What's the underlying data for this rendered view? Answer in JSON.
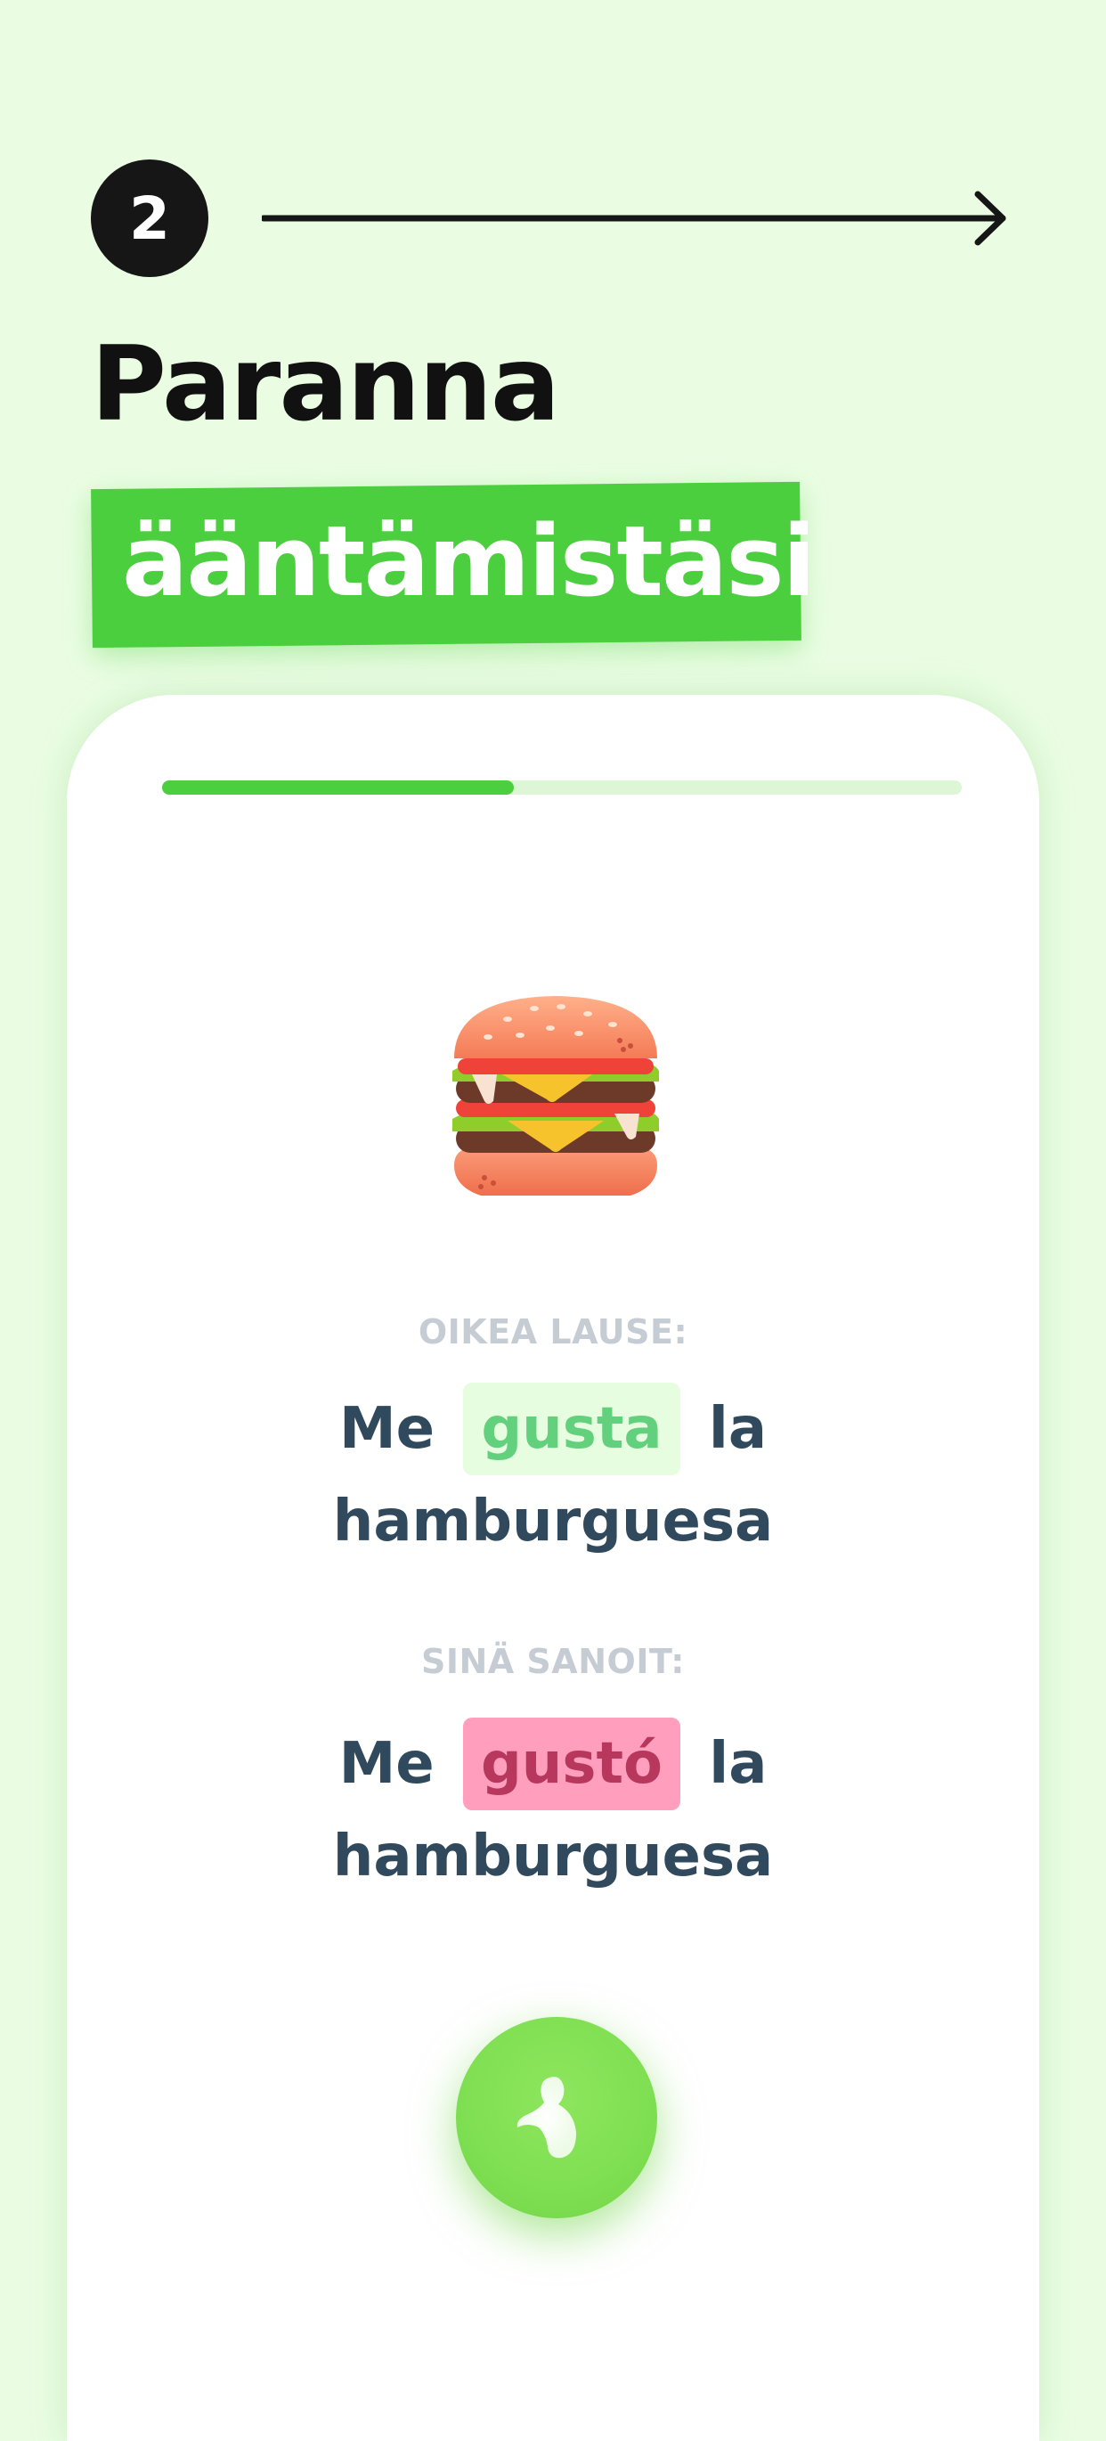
{
  "step": {
    "number": "2"
  },
  "headline": {
    "line1": "Paranna",
    "line2": "ääntämistäsi"
  },
  "lesson": {
    "progress": 0.44,
    "image": "burger-emoji",
    "correct_label": "OIKEA LAUSE:",
    "correct_sentence": {
      "before": "Me",
      "highlight": "gusta",
      "after_inline": "la",
      "line2": "hamburguesa"
    },
    "said_label": "SINÄ SANOIT:",
    "said_sentence": {
      "before": "Me",
      "highlight": "gustó",
      "after_inline": "la",
      "line2": "hamburguesa"
    },
    "mic_icon": "microphone-icon"
  },
  "colors": {
    "background": "#eafde3",
    "accent_green": "#4ccf3f",
    "text_dark": "#30495d",
    "correct_green": "#62d07d",
    "wrong_red": "#b7375d",
    "wrong_bg": "#ff9fbd"
  }
}
